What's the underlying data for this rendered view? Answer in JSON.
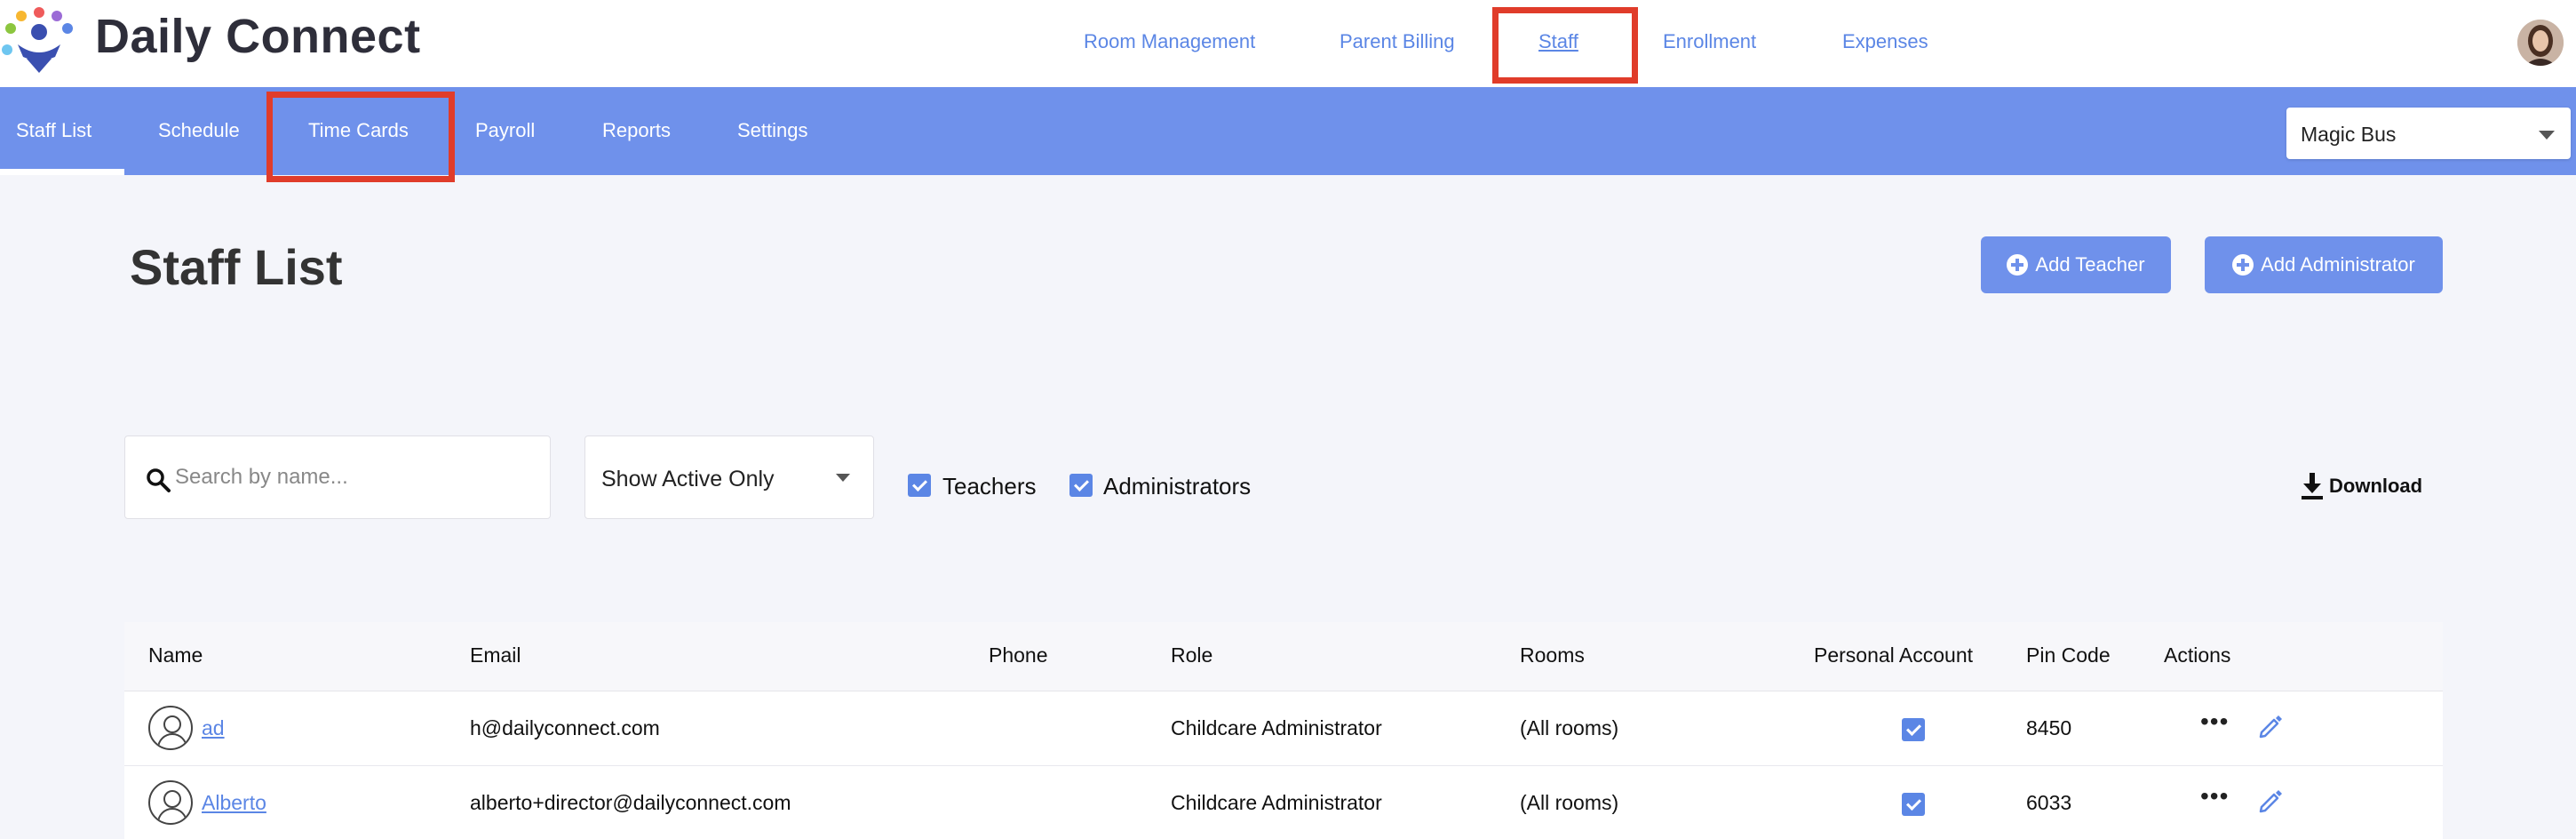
{
  "app": {
    "brand": "Daily Connect"
  },
  "top_nav": [
    {
      "label": "Room Management"
    },
    {
      "label": "Parent Billing"
    },
    {
      "label": "Staff",
      "active": true
    },
    {
      "label": "Enrollment"
    },
    {
      "label": "Expenses"
    }
  ],
  "sub_nav": [
    {
      "label": "Staff List",
      "active": true
    },
    {
      "label": "Schedule"
    },
    {
      "label": "Time Cards"
    },
    {
      "label": "Payroll"
    },
    {
      "label": "Reports"
    },
    {
      "label": "Settings"
    }
  ],
  "location_select": {
    "value": "Magic Bus"
  },
  "page": {
    "title": "Staff List",
    "add_teacher_label": "Add Teacher",
    "add_admin_label": "Add Administrator"
  },
  "filters": {
    "search_placeholder": "Search by name...",
    "status_value": "Show Active Only",
    "teachers_label": "Teachers",
    "teachers_checked": true,
    "administrators_label": "Administrators",
    "administrators_checked": true,
    "download_label": "Download"
  },
  "table": {
    "columns": [
      "Name",
      "Email",
      "Phone",
      "Role",
      "Rooms",
      "Personal Account",
      "Pin Code",
      "Actions"
    ],
    "rows": [
      {
        "name": "ad",
        "email": "h@dailyconnect.com",
        "phone": "",
        "role": "Childcare Administrator",
        "rooms": "(All rooms)",
        "personal_account": true,
        "pin": "8450"
      },
      {
        "name": "Alberto",
        "email": "alberto+director@dailyconnect.com",
        "phone": "",
        "role": "Childcare Administrator",
        "rooms": "(All rooms)",
        "personal_account": true,
        "pin": "6033"
      }
    ]
  },
  "colors": {
    "primary": "#6f91eb",
    "link": "#5b86e5",
    "highlight": "#e03c2a",
    "background": "#f4f5fa"
  },
  "icons": [
    "logo-icon",
    "search-icon",
    "download-icon",
    "plus-circle-icon",
    "more-icon",
    "pencil-icon",
    "user-avatar-icon",
    "chevron-down-icon"
  ]
}
